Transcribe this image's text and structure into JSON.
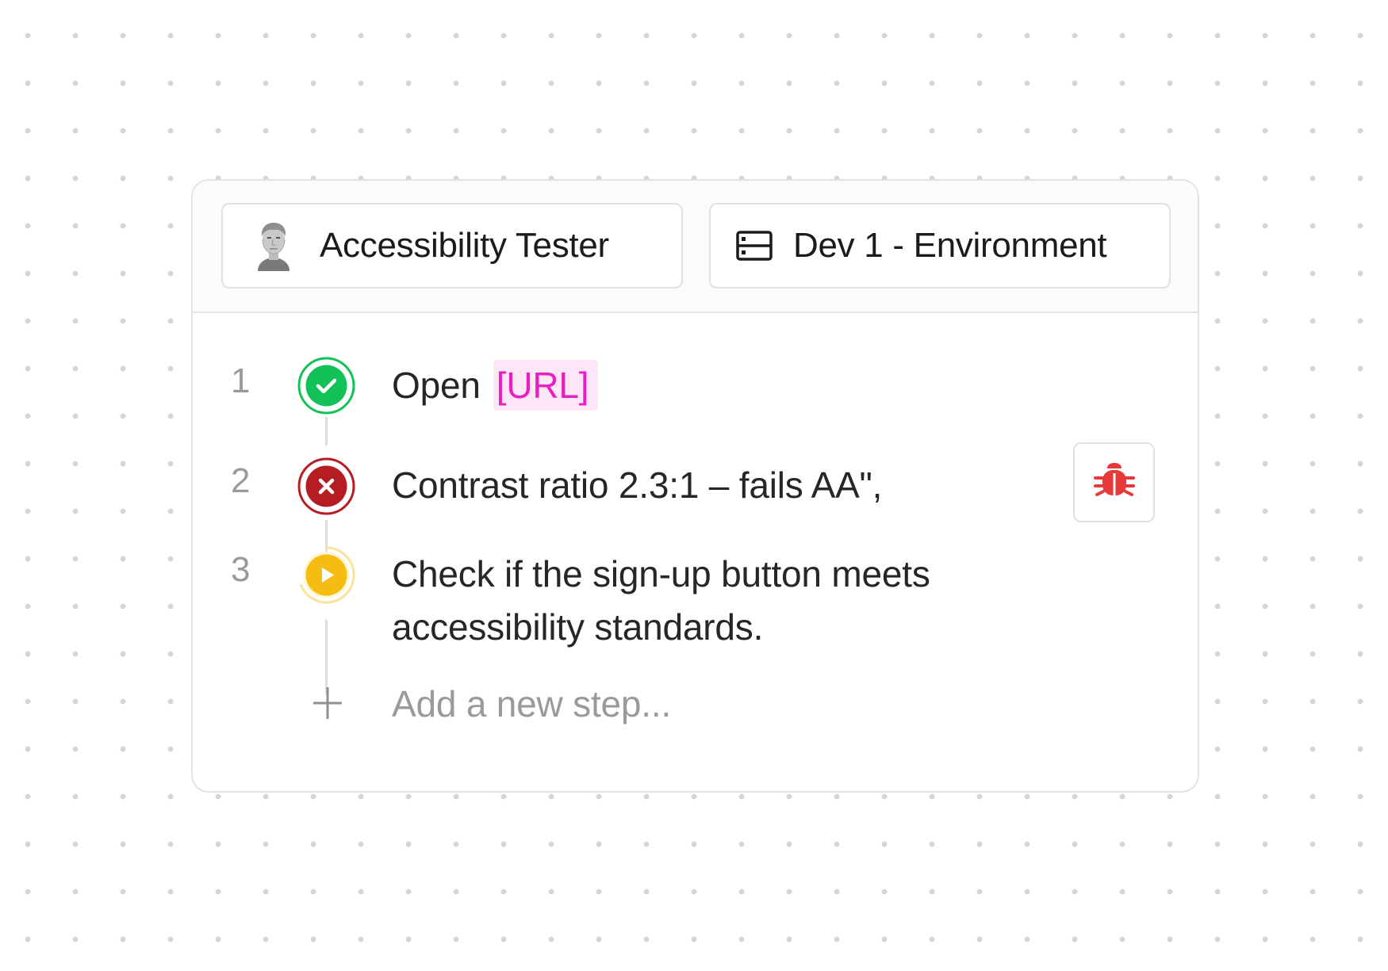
{
  "header": {
    "persona": {
      "label": "Accessibility Tester",
      "icon": "person-avatar-icon"
    },
    "environment": {
      "label": "Dev 1 - Environment",
      "icon": "server-icon"
    }
  },
  "steps": [
    {
      "number": "1",
      "status": "passed",
      "status_icon": "check-circle-icon",
      "status_color": "#12c157",
      "text": "Open",
      "token": "[URL]",
      "token_color": "#e81fc0",
      "token_bg": "#fde6f7"
    },
    {
      "number": "2",
      "status": "failed",
      "status_icon": "x-circle-icon",
      "status_color": "#b51d22",
      "text": "Contrast ratio 2.3:1 – fails AA\",",
      "action_icon": "bug-icon",
      "action_color": "#e63a3a"
    },
    {
      "number": "3",
      "status": "running",
      "status_icon": "play-circle-icon",
      "status_color": "#f5bd12",
      "text_line1": "Check if the sign-up button meets",
      "text_line2": "accessibility standards."
    }
  ],
  "add_step": {
    "icon": "plus-icon",
    "placeholder": "Add a new step..."
  }
}
